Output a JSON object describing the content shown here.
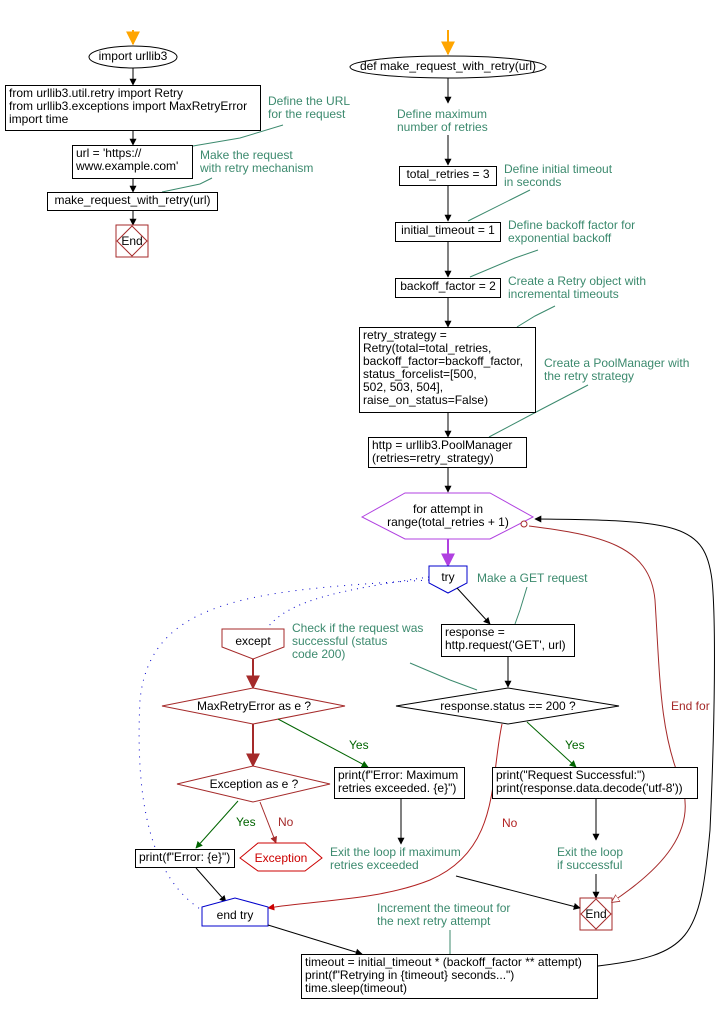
{
  "colors": {
    "start_arrow": "#ffa500",
    "flow": "#000000",
    "note_text": "#3c8a6e",
    "note_line": "#3c8a6e",
    "loop": "#b040e0",
    "try_block": "#0000cc",
    "except_block": "#a52a2a",
    "yes": "#006400",
    "no": "#b22222",
    "exception_terminal": "#cc0000",
    "end_terminal": "#a52a2a"
  },
  "main": {
    "start": "import urllib3",
    "imports": "from urllib3.util.retry import Retry\nfrom urllib3.exceptions import MaxRetryError\nimport time",
    "url_assign": "url = 'https://\nwww.example.com'",
    "call": "make_request_with_retry(url)",
    "end": "End",
    "notes": {
      "define_url": "Define the URL\nfor the request",
      "make_request": "Make the request\nwith retry mechanism"
    }
  },
  "func": {
    "start": "def make_request_with_retry(url)",
    "total_retries": "total_retries = 3",
    "initial_timeout": "initial_timeout = 1",
    "backoff_factor": "backoff_factor = 2",
    "retry_strategy": "retry_strategy =\nRetry(total=total_retries,\nbackoff_factor=backoff_factor,\nstatus_forcelist=[500,\n502, 503, 504],\nraise_on_status=False)",
    "pool_manager": "http = urllib3.PoolManager\n(retries=retry_strategy)",
    "loop": "for attempt in\nrange(total_retries + 1)",
    "try": "try",
    "response": "response =\nhttp.request('GET', url)",
    "status_check": "response.status == 200 ?",
    "success_print": "print(\"Request Successful:\")\nprint(response.data.decode('utf-8'))",
    "except": "except",
    "max_retry_check": "MaxRetryError as e ?",
    "max_retry_print": "print(f\"Error: Maximum\nretries exceeded. {e}\")",
    "exception_check": "Exception as e ?",
    "error_print": "print(f\"Error: {e}\")",
    "exception_terminal": "Exception",
    "end_try": "end try",
    "timeout_block": "timeout = initial_timeout * (backoff_factor ** attempt)\nprint(f\"Retrying in {timeout} seconds...\")\ntime.sleep(timeout)",
    "end": "End",
    "edge_labels": {
      "yes_max": "Yes",
      "yes_status": "Yes",
      "yes_exception": "Yes",
      "no_exception": "No",
      "no_status": "No",
      "end_for": "End for"
    },
    "notes": {
      "max_retries": "Define maximum\nnumber of retries",
      "initial_timeout": "Define initial timeout\nin seconds",
      "backoff": "Define backoff factor for\nexponential backoff",
      "retry_object": "Create a Retry object with\nincremental timeouts",
      "pool_manager": "Create a PoolManager with\nthe retry strategy",
      "get_request": "Make a GET request",
      "check_status": "Check if the request was\nsuccessful (status\ncode 200)",
      "exit_max": "Exit the loop if maximum\nretries exceeded",
      "exit_success": "Exit the loop\nif successful",
      "increment": "Increment the timeout for\nthe next retry attempt"
    }
  }
}
